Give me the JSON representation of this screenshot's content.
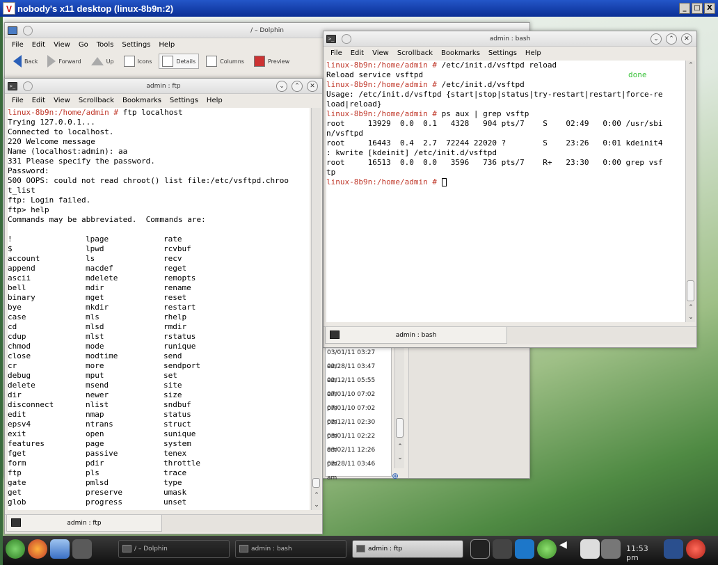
{
  "vnc": {
    "title": "nobody's x11 desktop (linux-8b9n:2)",
    "logo": "V",
    "controls": [
      "_",
      "□",
      "X"
    ]
  },
  "dolphin": {
    "title": "/ – Dolphin",
    "menu": [
      "File",
      "Edit",
      "View",
      "Go",
      "Tools",
      "Settings",
      "Help"
    ],
    "toolbar": [
      {
        "label": "Back",
        "icon": "back-arrow-icon"
      },
      {
        "label": "Forward",
        "icon": "forward-arrow-icon"
      },
      {
        "label": "Up",
        "icon": "up-arrow-icon"
      },
      {
        "label": "Icons",
        "icon": "icons-view-icon"
      },
      {
        "label": "Details",
        "icon": "details-view-icon"
      },
      {
        "label": "Columns",
        "icon": "columns-view-icon"
      },
      {
        "label": "Preview",
        "icon": "preview-icon"
      }
    ],
    "dates": [
      "03/01/11 03:27 am",
      "02/28/11 03:47 am",
      "02/12/11 05:55 am",
      "07/01/10 07:02 pm",
      "07/01/10 07:02 pm",
      "02/12/11 02:30 pm",
      "03/01/11 02:22 am",
      "03/02/11 12:26 pm",
      "02/28/11 03:46 am"
    ]
  },
  "bash": {
    "title": "admin : bash",
    "menu": [
      "File",
      "Edit",
      "View",
      "Scrollback",
      "Bookmarks",
      "Settings",
      "Help"
    ],
    "prompt": "linux-8b9n:/home/admin #",
    "lines": [
      {
        "p": true,
        "text": " /etc/init.d/vsftpd reload"
      },
      {
        "p": false,
        "text": "Reload service vsftpd",
        "status": "done"
      },
      {
        "p": true,
        "text": " /etc/init.d/vsftpd"
      },
      {
        "p": false,
        "text": "Usage: /etc/init.d/vsftpd {start|stop|status|try-restart|restart|force-re"
      },
      {
        "p": false,
        "text": "load|reload}"
      },
      {
        "p": true,
        "text": " ps aux | grep vsftp"
      },
      {
        "p": false,
        "text": "root     13929  0.0  0.1   4328   904 pts/7    S    02:49   0:00 /usr/sbi"
      },
      {
        "p": false,
        "text": "n/vsftpd"
      },
      {
        "p": false,
        "text": "root     16443  0.4  2.7  72244 22020 ?        S    23:26   0:01 kdeinit4"
      },
      {
        "p": false,
        "text": ": kwrite [kdeinit] /etc/init.d/vsftpd"
      },
      {
        "p": false,
        "text": "root     16513  0.0  0.0   3596   736 pts/7    R+   23:30   0:00 grep vsf"
      },
      {
        "p": false,
        "text": "tp"
      },
      {
        "p": true,
        "text": " ",
        "cursor": true
      }
    ],
    "tab": "admin : bash"
  },
  "ftp": {
    "title": "admin : ftp",
    "menu": [
      "File",
      "Edit",
      "View",
      "Scrollback",
      "Bookmarks",
      "Settings",
      "Help"
    ],
    "prompt": "linux-8b9n:/home/admin #",
    "head": [
      {
        "p": true,
        "text": " ftp localhost"
      },
      {
        "p": false,
        "text": "Trying 127.0.0.1..."
      },
      {
        "p": false,
        "text": "Connected to localhost."
      },
      {
        "p": false,
        "text": "220 Welcome message"
      },
      {
        "p": false,
        "text": "Name (localhost:admin): aa"
      },
      {
        "p": false,
        "text": "331 Please specify the password."
      },
      {
        "p": false,
        "text": "Password:"
      },
      {
        "p": false,
        "text": "500 OOPS: could not read chroot() list file:/etc/vsftpd.chroo"
      },
      {
        "p": false,
        "text": "t_list"
      },
      {
        "p": false,
        "text": "ftp: Login failed."
      },
      {
        "p": false,
        "text": "ftp> help"
      },
      {
        "p": false,
        "text": "Commands may be abbreviated.  Commands are:"
      },
      {
        "p": false,
        "text": ""
      }
    ],
    "commands": [
      [
        "!",
        "lpage",
        "rate"
      ],
      [
        "$",
        "lpwd",
        "rcvbuf"
      ],
      [
        "account",
        "ls",
        "recv"
      ],
      [
        "append",
        "macdef",
        "reget"
      ],
      [
        "ascii",
        "mdelete",
        "remopts"
      ],
      [
        "bell",
        "mdir",
        "rename"
      ],
      [
        "binary",
        "mget",
        "reset"
      ],
      [
        "bye",
        "mkdir",
        "restart"
      ],
      [
        "case",
        "mls",
        "rhelp"
      ],
      [
        "cd",
        "mlsd",
        "rmdir"
      ],
      [
        "cdup",
        "mlst",
        "rstatus"
      ],
      [
        "chmod",
        "mode",
        "runique"
      ],
      [
        "close",
        "modtime",
        "send"
      ],
      [
        "cr",
        "more",
        "sendport"
      ],
      [
        "debug",
        "mput",
        "set"
      ],
      [
        "delete",
        "msend",
        "site"
      ],
      [
        "dir",
        "newer",
        "size"
      ],
      [
        "disconnect",
        "nlist",
        "sndbuf"
      ],
      [
        "edit",
        "nmap",
        "status"
      ],
      [
        "epsv4",
        "ntrans",
        "struct"
      ],
      [
        "exit",
        "open",
        "sunique"
      ],
      [
        "features",
        "page",
        "system"
      ],
      [
        "fget",
        "passive",
        "tenex"
      ],
      [
        "form",
        "pdir",
        "throttle"
      ],
      [
        "ftp",
        "pls",
        "trace"
      ],
      [
        "gate",
        "pmlsd",
        "type"
      ],
      [
        "get",
        "preserve",
        "umask"
      ],
      [
        "glob",
        "progress",
        "unset"
      ]
    ],
    "tab": "admin : ftp"
  },
  "taskbar": {
    "tasks": [
      {
        "label": "/ – Dolphin",
        "active": false
      },
      {
        "label": "admin : bash",
        "active": false
      },
      {
        "label": "admin : ftp",
        "active": true
      }
    ],
    "clock": "11:53 pm"
  }
}
